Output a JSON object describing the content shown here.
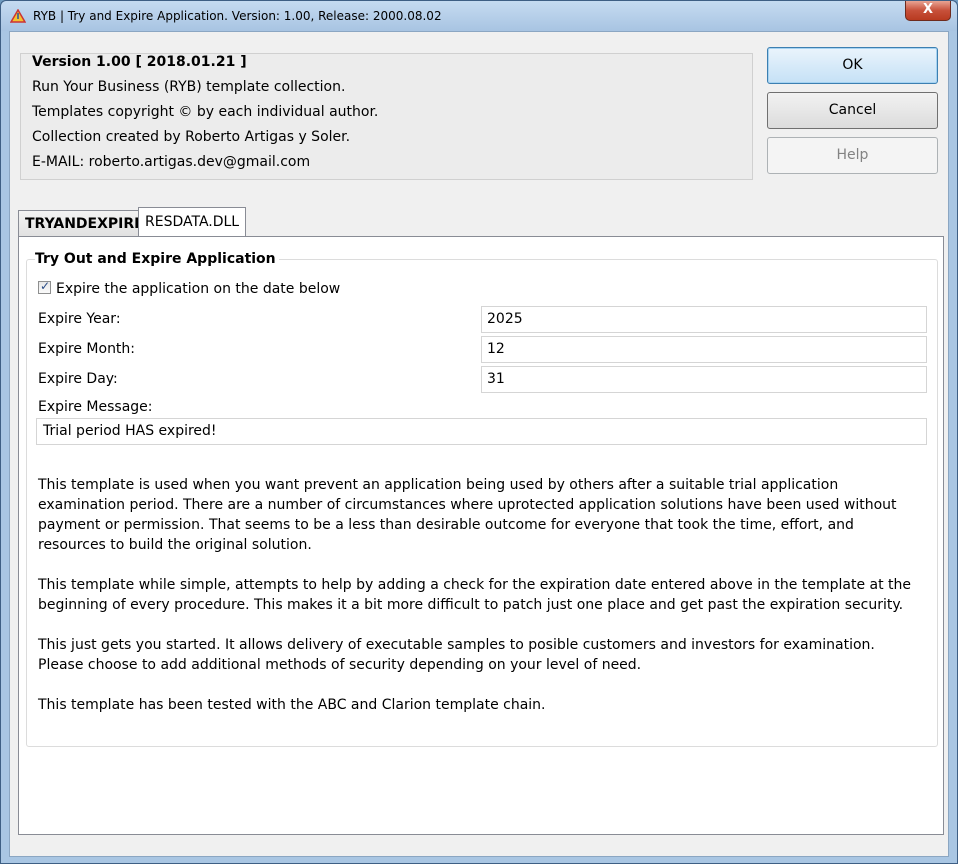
{
  "window": {
    "title": "RYB | Try and Expire Application. Version: 1.00, Release: 2000.08.02",
    "close_label": "X"
  },
  "info": {
    "version": "Version 1.00 [ 2018.01.21 ]",
    "line1": "Run Your Business (RYB) template collection.",
    "line2": "Templates copyright © by each individual author.",
    "line3": "Collection created by Roberto Artigas y Soler.",
    "line4": "E-MAIL: roberto.artigas.dev@gmail.com"
  },
  "buttons": {
    "ok": "OK",
    "cancel": "Cancel",
    "help": "Help"
  },
  "tabs": [
    {
      "label": "TRYANDEXPIRE"
    },
    {
      "label": "RESDATA.DLL"
    }
  ],
  "group": {
    "title": "Try Out and Expire Application",
    "checkbox_label": "Expire the application on the date below",
    "checked": true,
    "year_label": "Expire Year:",
    "year_value": "2025",
    "month_label": "Expire Month:",
    "month_value": "12",
    "day_label": "Expire Day:",
    "day_value": "31",
    "message_label": "Expire Message:",
    "message_value": "Trial period HAS expired!"
  },
  "description": {
    "p1": "This template is used when you want prevent an application being used by others after a suitable trial application examination period. There are a number of circumstances where uprotected application solutions have been used without payment or permission. That seems to be a less than desirable outcome for everyone that took the time, effort, and resources to build the original solution.",
    "p2": "This template while simple, attempts to help by adding a check for the expiration date entered above in the template at the beginning of every procedure. This makes it a bit more difficult to patch just one place and get past the expiration security.",
    "p3": "This just gets you started. It allows delivery of executable samples to posible customers and investors for examination. Please choose to add additional methods of security depending on your level of need.",
    "p4": "This template has been tested with the ABC and Clarion template chain."
  },
  "colors": {
    "accent": "#3c7fb1",
    "close": "#c7503a",
    "frame": "#a9c6e3"
  }
}
